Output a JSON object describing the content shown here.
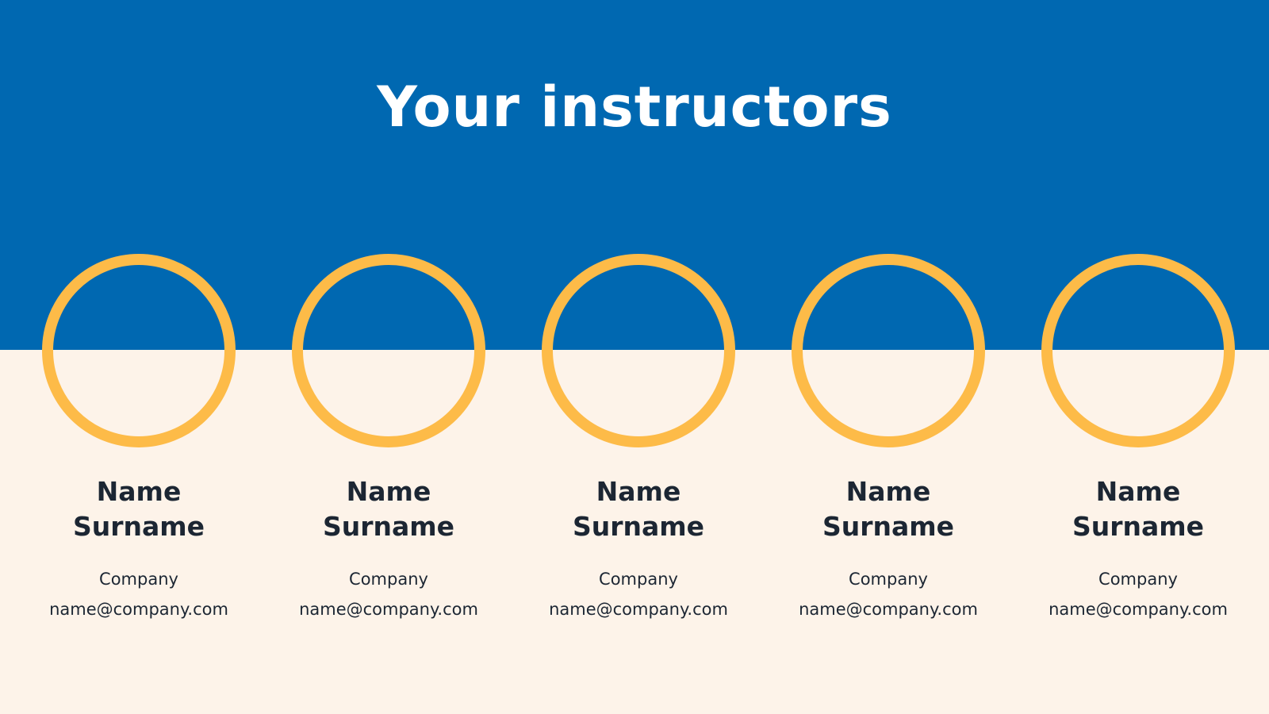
{
  "slide": {
    "title": "Your instructors",
    "colors": {
      "band": "#0068b1",
      "background": "#fdf3e9",
      "ring": "#fdbb48",
      "text_dark": "#1c2633",
      "title_text": "#ffffff"
    }
  },
  "instructors": [
    {
      "first": "Name",
      "last": "Surname",
      "company": "Company",
      "email": "name@company.com"
    },
    {
      "first": "Name",
      "last": "Surname",
      "company": "Company",
      "email": "name@company.com"
    },
    {
      "first": "Name",
      "last": "Surname",
      "company": "Company",
      "email": "name@company.com"
    },
    {
      "first": "Name",
      "last": "Surname",
      "company": "Company",
      "email": "name@company.com"
    },
    {
      "first": "Name",
      "last": "Surname",
      "company": "Company",
      "email": "name@company.com"
    }
  ]
}
